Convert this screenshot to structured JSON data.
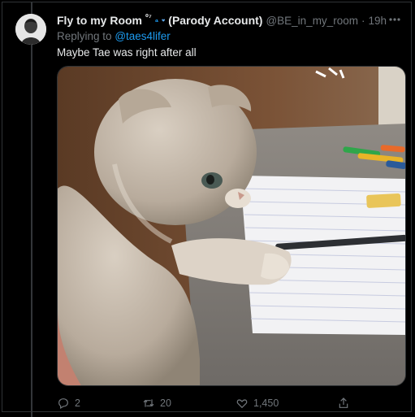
{
  "tweet": {
    "display_name": "Fly to my Room",
    "name_superscript": "⁰⁷",
    "name_suffix": "(Parody Account)",
    "handle": "@BE_in_my_room",
    "separator": "·",
    "time": "19h",
    "replying_prefix": "Replying to",
    "replying_to": "@taes4lifer",
    "text": "Maybe Tae was right after all",
    "media_icon": "photo-cat-with-notebook",
    "more_icon": "more-horizontal-icon"
  },
  "actions": {
    "reply": {
      "icon": "reply-icon",
      "count": "2"
    },
    "retweet": {
      "icon": "retweet-icon",
      "count": "20"
    },
    "like": {
      "icon": "heart-icon",
      "count": "1,450"
    },
    "share": {
      "icon": "share-icon"
    }
  },
  "colors": {
    "background": "#000000",
    "text": "#e7e9ea",
    "muted": "#71767b",
    "link": "#1d9bf0",
    "border": "#2f3336"
  }
}
